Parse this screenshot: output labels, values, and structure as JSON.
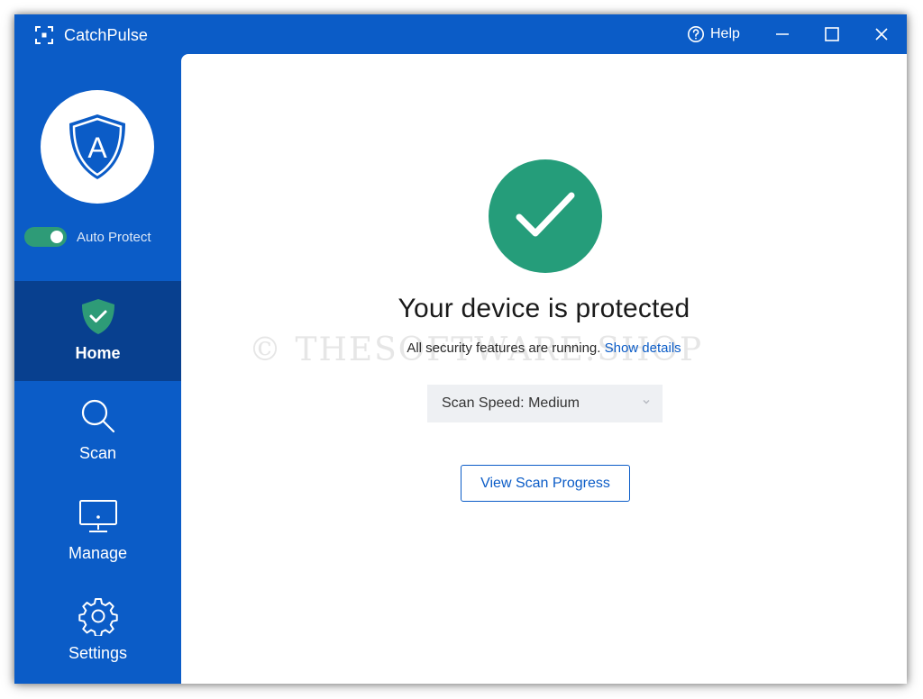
{
  "titlebar": {
    "app_title": "CatchPulse",
    "help_label": "Help",
    "logo_icon": "focus-frame-icon"
  },
  "sidebar": {
    "avatar_letter": "A",
    "auto_protect": {
      "label": "Auto Protect",
      "enabled": true
    },
    "items": [
      {
        "label": "Home",
        "icon": "shield-check-icon",
        "active": true
      },
      {
        "label": "Scan",
        "icon": "search-icon",
        "active": false
      },
      {
        "label": "Manage",
        "icon": "monitor-icon",
        "active": false
      },
      {
        "label": "Settings",
        "icon": "gear-icon",
        "active": false
      }
    ]
  },
  "main": {
    "status_title": "Your device is protected",
    "status_subtitle": "All security features are running.",
    "show_details_link": "Show details",
    "scan_speed": {
      "selected": "Scan Speed: Medium"
    },
    "view_progress_button": "View Scan Progress",
    "watermark": "© THESOFTWARE.SHOP"
  },
  "colors": {
    "brand_blue": "#0b5cc7",
    "active_nav": "#08408f",
    "success_green": "#259d7a",
    "toggle_green": "#2e9b77"
  }
}
